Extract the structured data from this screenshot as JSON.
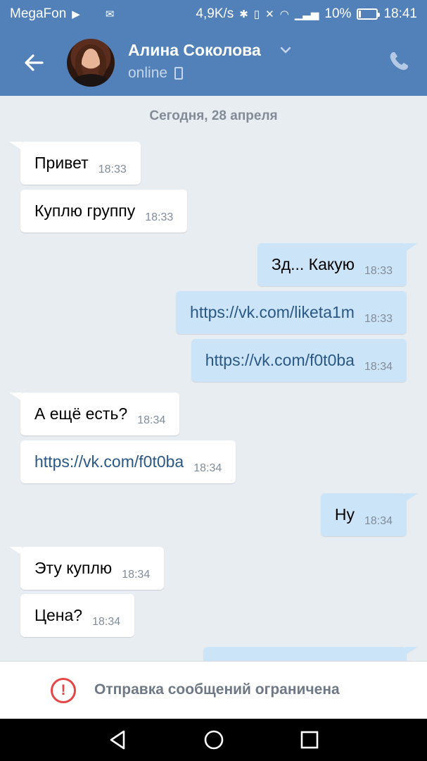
{
  "status_bar": {
    "carrier": "MegaFon",
    "speed": "4,9K/s",
    "battery_percent": "10%",
    "battery_level": 0.1,
    "time": "18:41"
  },
  "header": {
    "contact_name": "Алина Соколова",
    "presence": "online",
    "back_icon": "arrow-left-icon",
    "call_icon": "phone-icon"
  },
  "chat": {
    "date_separator": "Сегодня, 28 апреля",
    "messages": [
      {
        "dir": "in",
        "text": "Привет",
        "time": "18:33",
        "link": false
      },
      {
        "dir": "in",
        "text": "Куплю группу",
        "time": "18:33",
        "link": false
      },
      {
        "dir": "out",
        "text": "Зд... Какую",
        "time": "18:33",
        "link": false
      },
      {
        "dir": "out",
        "text": "https://vk.com/liketa1m",
        "time": "18:33",
        "link": true
      },
      {
        "dir": "out",
        "text": "https://vk.com/f0t0ba",
        "time": "18:34",
        "link": true
      },
      {
        "dir": "in",
        "text": "А ещё есть?",
        "time": "18:34",
        "link": false
      },
      {
        "dir": "in",
        "text": "https://vk.com/f0t0ba",
        "time": "18:34",
        "link": true
      },
      {
        "dir": "out",
        "text": "Ну",
        "time": "18:34",
        "link": false
      },
      {
        "dir": "in",
        "text": "Эту куплю",
        "time": "18:34",
        "link": false
      },
      {
        "dir": "in",
        "text": "Цена?",
        "time": "18:34",
        "link": false
      }
    ]
  },
  "restriction": {
    "icon": "exclamation-circle-icon",
    "text": "Отправка сообщений ограничена"
  },
  "colors": {
    "header_bg": "#5181b8",
    "chat_bg": "#e8edf2",
    "out_bubble": "#cce4f7",
    "link": "#2a5885",
    "warning": "#e64646"
  }
}
